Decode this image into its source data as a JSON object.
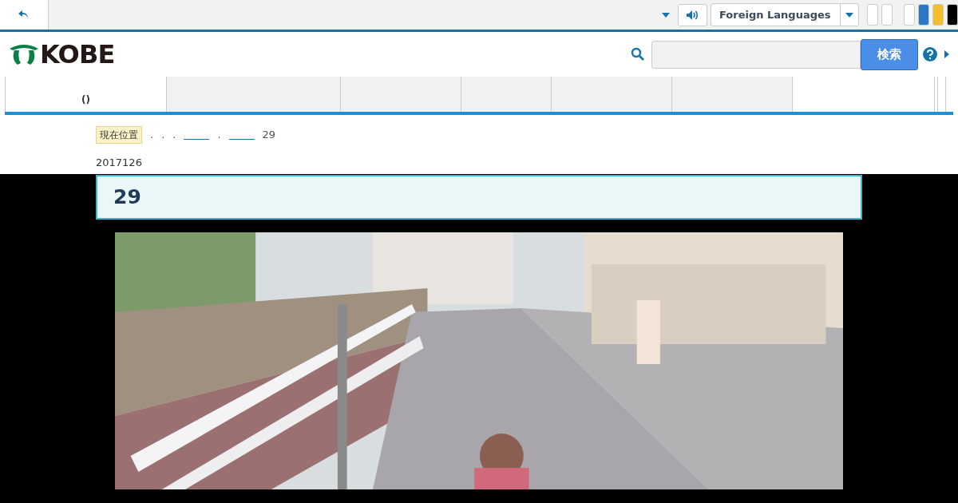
{
  "topbar": {
    "language_select": {
      "value": "Foreign Languages"
    },
    "color_swatches": [
      {
        "color": "#ffffff"
      },
      {
        "color": "#2a78c6"
      },
      {
        "color": "#f5be2e"
      },
      {
        "color": "#000000"
      }
    ]
  },
  "header": {
    "logo_text": "KOBE",
    "search": {
      "button": "検索"
    }
  },
  "nav_tabs": [
    {
      "label": "()",
      "shaded": false
    },
    {
      "shaded": true
    },
    {
      "shaded": true
    },
    {
      "shaded": true
    },
    {
      "shaded": true
    },
    {
      "shaded": true
    },
    {
      "shaded": false
    }
  ],
  "breadcrumb": {
    "label": "現在位置",
    "items": [
      {
        "kind": "text",
        "text": "."
      },
      {
        "kind": "text",
        "text": "."
      },
      {
        "kind": "text",
        "text": "."
      },
      {
        "kind": "link"
      },
      {
        "kind": "text",
        "text": "."
      },
      {
        "kind": "link"
      },
      {
        "kind": "text",
        "text": "29"
      }
    ]
  },
  "date": "2017126",
  "heading": "29"
}
